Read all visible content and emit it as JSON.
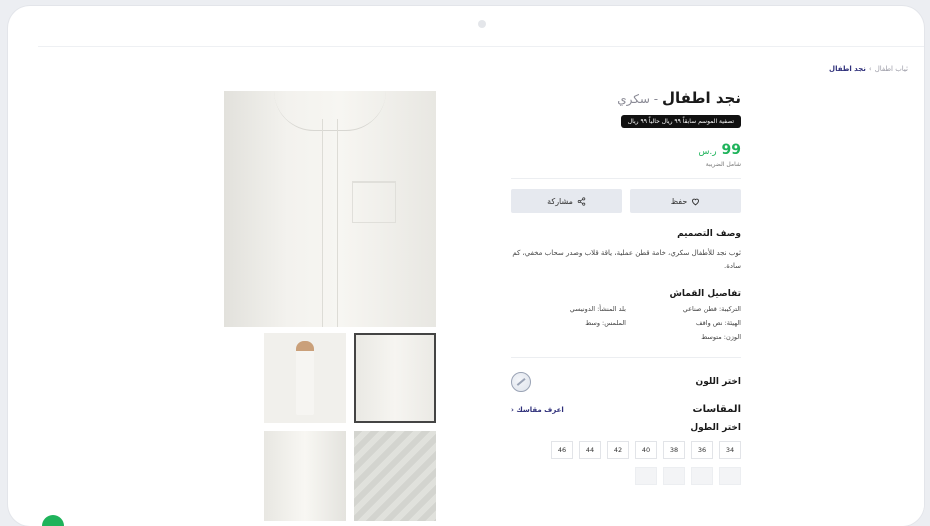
{
  "breadcrumb": {
    "parent": "ثياب اطفال",
    "separator": "›",
    "current": "نجد اطفال"
  },
  "product": {
    "name": "نجد اطفال",
    "variant_sep": " - ",
    "variant": "سكري",
    "promo": "تصفية الموسم سابقاً ٩٩ ريال حالياً ٩٩ ريال",
    "price": "99",
    "currency": "ر.س",
    "tax_note": "شامل الضريبة"
  },
  "actions": {
    "save_label": "حفظ",
    "share_label": "مشاركة"
  },
  "design": {
    "heading": "وصف التصميم",
    "text": "ثوب نجد للأطفال سكري، خامة قطن عملية، ياقة قلاب وصدر سحاب مخفي، كم سادة."
  },
  "fabric": {
    "heading": "تفاصيل القماش",
    "specs": [
      "التركيبة: قطن صناعي",
      "بلد المنشأ: الدونيسي",
      "الهيئة: نص واقف",
      "الملمس: وسط",
      "الوزن: متوسط"
    ]
  },
  "color": {
    "label": "اختر اللون"
  },
  "sizes": {
    "heading": "المقاسات",
    "link": "اعرف مقاسك ‹",
    "length_label": "اختر الطول",
    "values": [
      "34",
      "36",
      "38",
      "40",
      "42",
      "44",
      "46"
    ]
  },
  "colors": {
    "accent": "#2e2f7a",
    "price": "#1fb35b",
    "button_bg": "#e6e9ef"
  }
}
